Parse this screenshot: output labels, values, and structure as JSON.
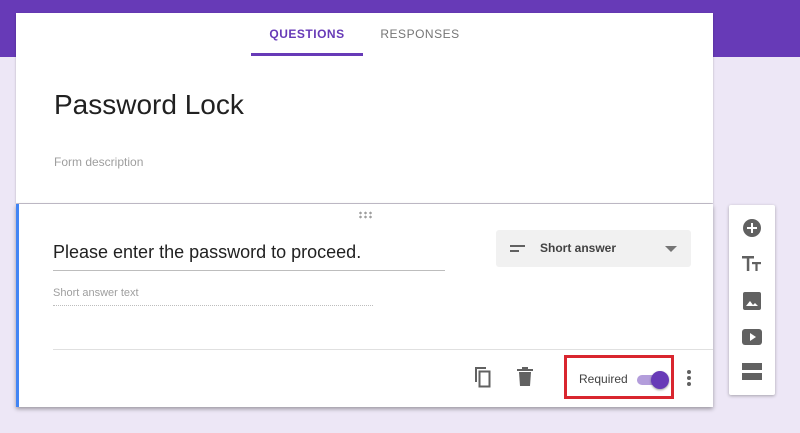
{
  "tabs": [
    {
      "label": "QUESTIONS",
      "active": true
    },
    {
      "label": "RESPONSES",
      "active": false
    }
  ],
  "form": {
    "title": "Password Lock",
    "description_placeholder": "Form description"
  },
  "question": {
    "text": "Please enter the password to proceed.",
    "answer_placeholder": "Short answer text",
    "type_label": "Short answer"
  },
  "footer": {
    "required_label": "Required",
    "required_on": true
  },
  "side_toolbar": [
    "add-question-icon",
    "add-title-icon",
    "add-image-icon",
    "add-video-icon",
    "add-section-icon"
  ],
  "colors": {
    "brand": "#673ab7",
    "accent_bar": "#4285f4",
    "highlight": "#d9262f"
  }
}
